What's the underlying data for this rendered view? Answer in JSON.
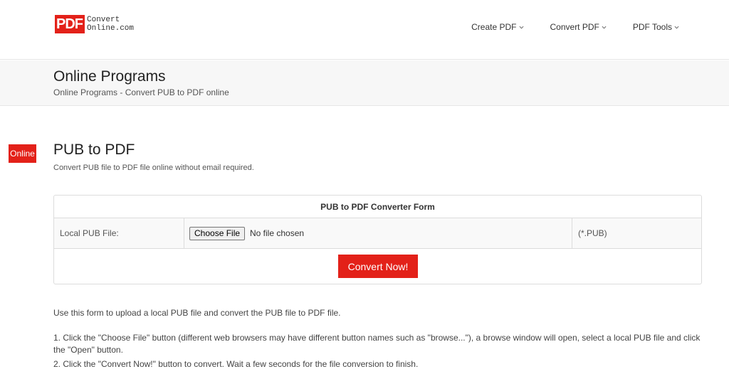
{
  "brand": {
    "logo_mark": "PDF",
    "logo_line1": "Convert",
    "logo_line2": "Online.com",
    "accent_color": "#e32119"
  },
  "nav": {
    "items": [
      {
        "label": "Create PDF"
      },
      {
        "label": "Convert PDF"
      },
      {
        "label": "PDF Tools"
      }
    ]
  },
  "band": {
    "title": "Online Programs",
    "breadcrumb": "Online Programs - Convert PUB to PDF online"
  },
  "badge": "Online",
  "tool": {
    "title": "PUB to PDF",
    "subtitle": "Convert PUB file to PDF file online without email required."
  },
  "form": {
    "heading": "PUB to PDF Converter Form",
    "file_label": "Local PUB File:",
    "choose_button": "Choose File",
    "file_status": "No file chosen",
    "extension": "(*.PUB)",
    "submit_label": "Convert Now!"
  },
  "instructions": {
    "intro": "Use this form to upload a local PUB file and convert the PUB file to PDF file.",
    "step1": "1. Click the \"Choose File\" button (different web browsers may have different button names such as \"browse...\"), a browse window will open, select a local PUB file and click the \"Open\" button.",
    "step2": "2. Click the \"Convert Now!\" button to convert. Wait a few seconds for the file conversion to finish."
  }
}
